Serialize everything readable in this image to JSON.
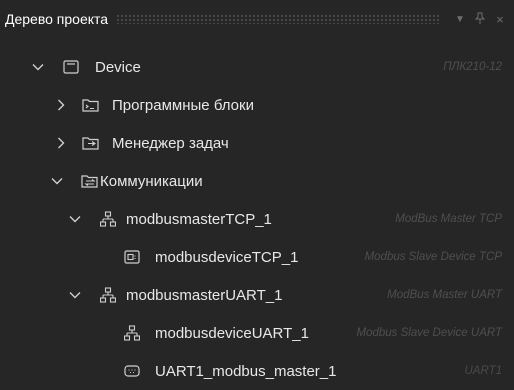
{
  "header": {
    "title": "Дерево проекта"
  },
  "tree": [
    {
      "label": "Device",
      "desc": "ПЛК210-12"
    },
    {
      "label": "Программные блоки",
      "desc": ""
    },
    {
      "label": "Менеджер задач",
      "desc": ""
    },
    {
      "label": "Коммуникации",
      "desc": ""
    },
    {
      "label": "modbusmasterTCP_1",
      "desc": "ModBus Master TCP"
    },
    {
      "label": "modbusdeviceTCP_1",
      "desc": "Modbus Slave Device TCP"
    },
    {
      "label": "modbusmasterUART_1",
      "desc": "ModBus Master UART"
    },
    {
      "label": "modbusdeviceUART_1",
      "desc": "Modbus Slave Device UART"
    },
    {
      "label": "UART1_modbus_master_1",
      "desc": "UART1"
    }
  ]
}
